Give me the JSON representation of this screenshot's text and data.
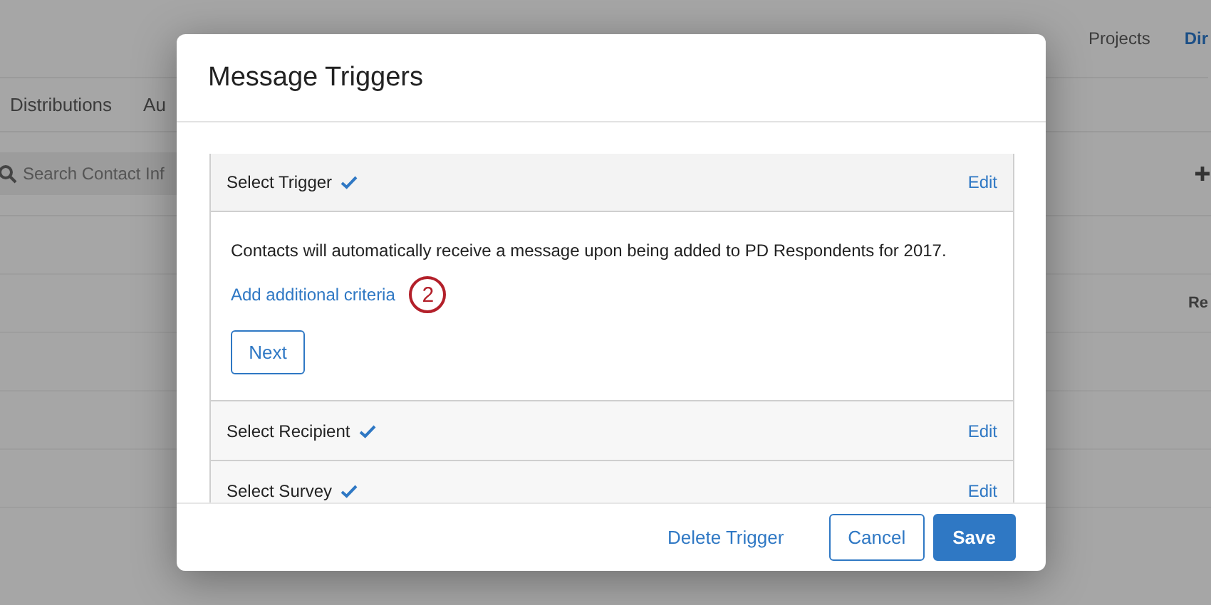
{
  "background_page": {
    "top_nav": [
      {
        "label": "Projects",
        "selected": false
      },
      {
        "label": "Dir",
        "selected": true
      }
    ],
    "tabs": [
      {
        "label": "Distributions"
      },
      {
        "label": "Au"
      }
    ],
    "search": {
      "placeholder": "Search Contact Inf"
    },
    "column_1": "Re"
  },
  "dialog": {
    "title": "Message Triggers",
    "steps": [
      {
        "title": "Select Trigger",
        "complete": true,
        "edit_label": "Edit",
        "expanded": true,
        "description": "Contacts will automatically receive a message upon being added to PD Respondents for 2017.",
        "link": "Add additional criteria",
        "annotation": "2",
        "next_label": "Next"
      },
      {
        "title": "Select Recipient",
        "complete": true,
        "edit_label": "Edit",
        "expanded": false
      },
      {
        "title": "Select Survey",
        "complete": true,
        "edit_label": "Edit",
        "expanded": false
      }
    ],
    "buttons": [
      {
        "label": "Delete Trigger",
        "kind": "link"
      },
      {
        "label": "Cancel",
        "kind": "secondary"
      },
      {
        "label": "Save",
        "kind": "primary"
      }
    ]
  }
}
